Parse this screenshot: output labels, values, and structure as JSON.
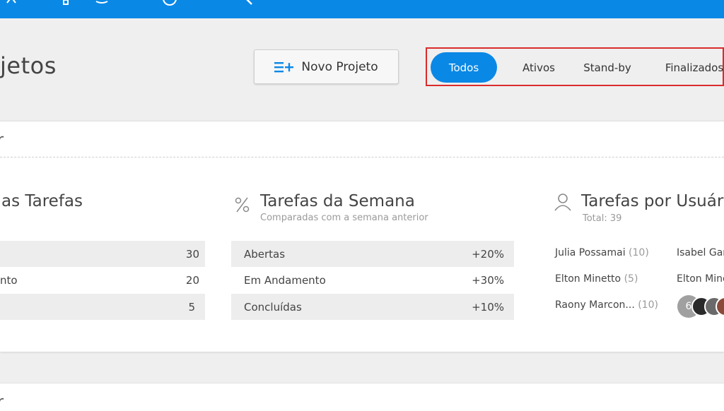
{
  "header": {
    "page_title": "jetos",
    "new_project_label": "Novo Projeto"
  },
  "filters": {
    "tabs": [
      {
        "label": "Todos",
        "active": true
      },
      {
        "label": "Ativos",
        "active": false
      },
      {
        "label": "Stand-by",
        "active": false
      },
      {
        "label": "Finalizados",
        "active": false
      }
    ]
  },
  "card": {
    "header_text": "r",
    "all_tasks": {
      "title": "as Tarefas",
      "rows": [
        {
          "label": "",
          "value": "30"
        },
        {
          "label": "nto",
          "value": "20"
        },
        {
          "label": "",
          "value": "5"
        }
      ]
    },
    "week_tasks": {
      "title": "Tarefas da Semana",
      "subtitle": "Comparadas com a semana anterior",
      "rows": [
        {
          "label": "Abertas",
          "value": "+20%"
        },
        {
          "label": "Em Andamento",
          "value": "+30%"
        },
        {
          "label": "Concluídas",
          "value": "+10%"
        }
      ]
    },
    "user_tasks": {
      "title": "Tarefas por Usuário",
      "total": "Total: 39",
      "users": [
        {
          "name": "Julia Possamai",
          "count": "(10)"
        },
        {
          "name": "Isabel Gar",
          "count": ""
        },
        {
          "name": "Elton Minetto",
          "count": "(5)"
        },
        {
          "name": "Elton Mine",
          "count": ""
        },
        {
          "name": "Raony  Marcon...",
          "count": "(10)"
        }
      ],
      "more_count": "6"
    }
  },
  "bottom_card": {
    "header_text": "r"
  },
  "colors": {
    "accent": "#0a88e6",
    "highlight_border": "#d92b2b",
    "row_shade": "#ededed"
  }
}
